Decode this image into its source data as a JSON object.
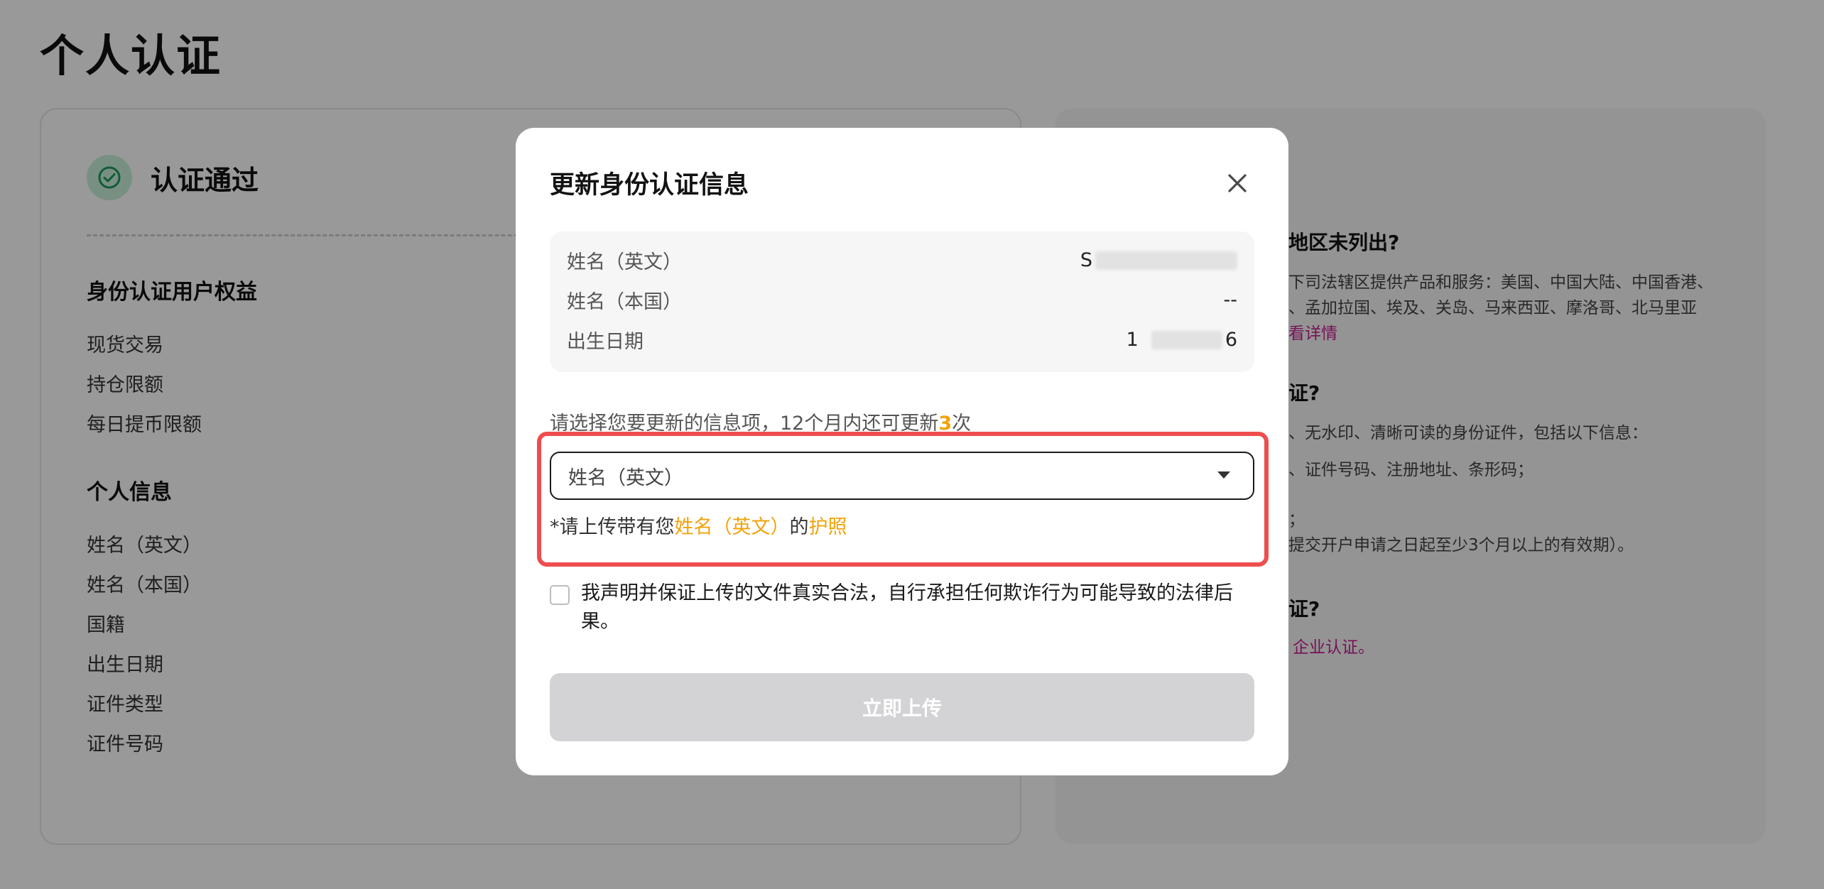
{
  "page": {
    "title": "个人认证"
  },
  "left_card": {
    "status": "认证通过",
    "benefits": {
      "title": "身份认证用户权益",
      "items": [
        "现货交易",
        "持仓限额",
        "每日提币限额"
      ]
    },
    "personal": {
      "title": "个人信息",
      "items": [
        "姓名（英文）",
        "姓名（本国）",
        "国籍",
        "出生日期",
        "证件类型",
        "证件号码"
      ]
    }
  },
  "right_card": {
    "q1_heading": "地区未列出?",
    "q1_line1": "下司法辖区提供产品和服务：美国、中国大陆、中国香港、",
    "q1_line2": "、孟加拉国、埃及、关岛、马来西亚、摩洛哥、北马里亚",
    "q1_link": "看详情",
    "q2_heading": "证?",
    "q2_line1": "、无水印、清晰可读的身份证件，包括以下信息：",
    "q2_line2": "、证件号码、注册地址、条形码；",
    "q2_line3": "；",
    "q2_line4": "提交开户申请之日起至少3个月以上的有效期）。",
    "q3_heading": "证?",
    "q3_link": "企业认证。"
  },
  "modal": {
    "title": "更新身份认证信息",
    "info": [
      {
        "label": "姓名（英文）",
        "value": "S"
      },
      {
        "label": "姓名（本国）",
        "value": "--"
      },
      {
        "label": "出生日期",
        "value": "1"
      }
    ],
    "dob_value_end": "6",
    "hint_prefix": "请选择您要更新的信息项，12个月内还可更新",
    "hint_count": "3",
    "hint_suffix": "次",
    "select_value": "姓名（英文）",
    "note_prefix": "*请上传带有您",
    "note_field": "姓名（英文）",
    "note_mid": "的",
    "note_doc": "护照",
    "declaration": "我声明并保证上传的文件真实合法，自行承担任何欺诈行为可能导致的法律后果。",
    "upload_label": "立即上传"
  }
}
